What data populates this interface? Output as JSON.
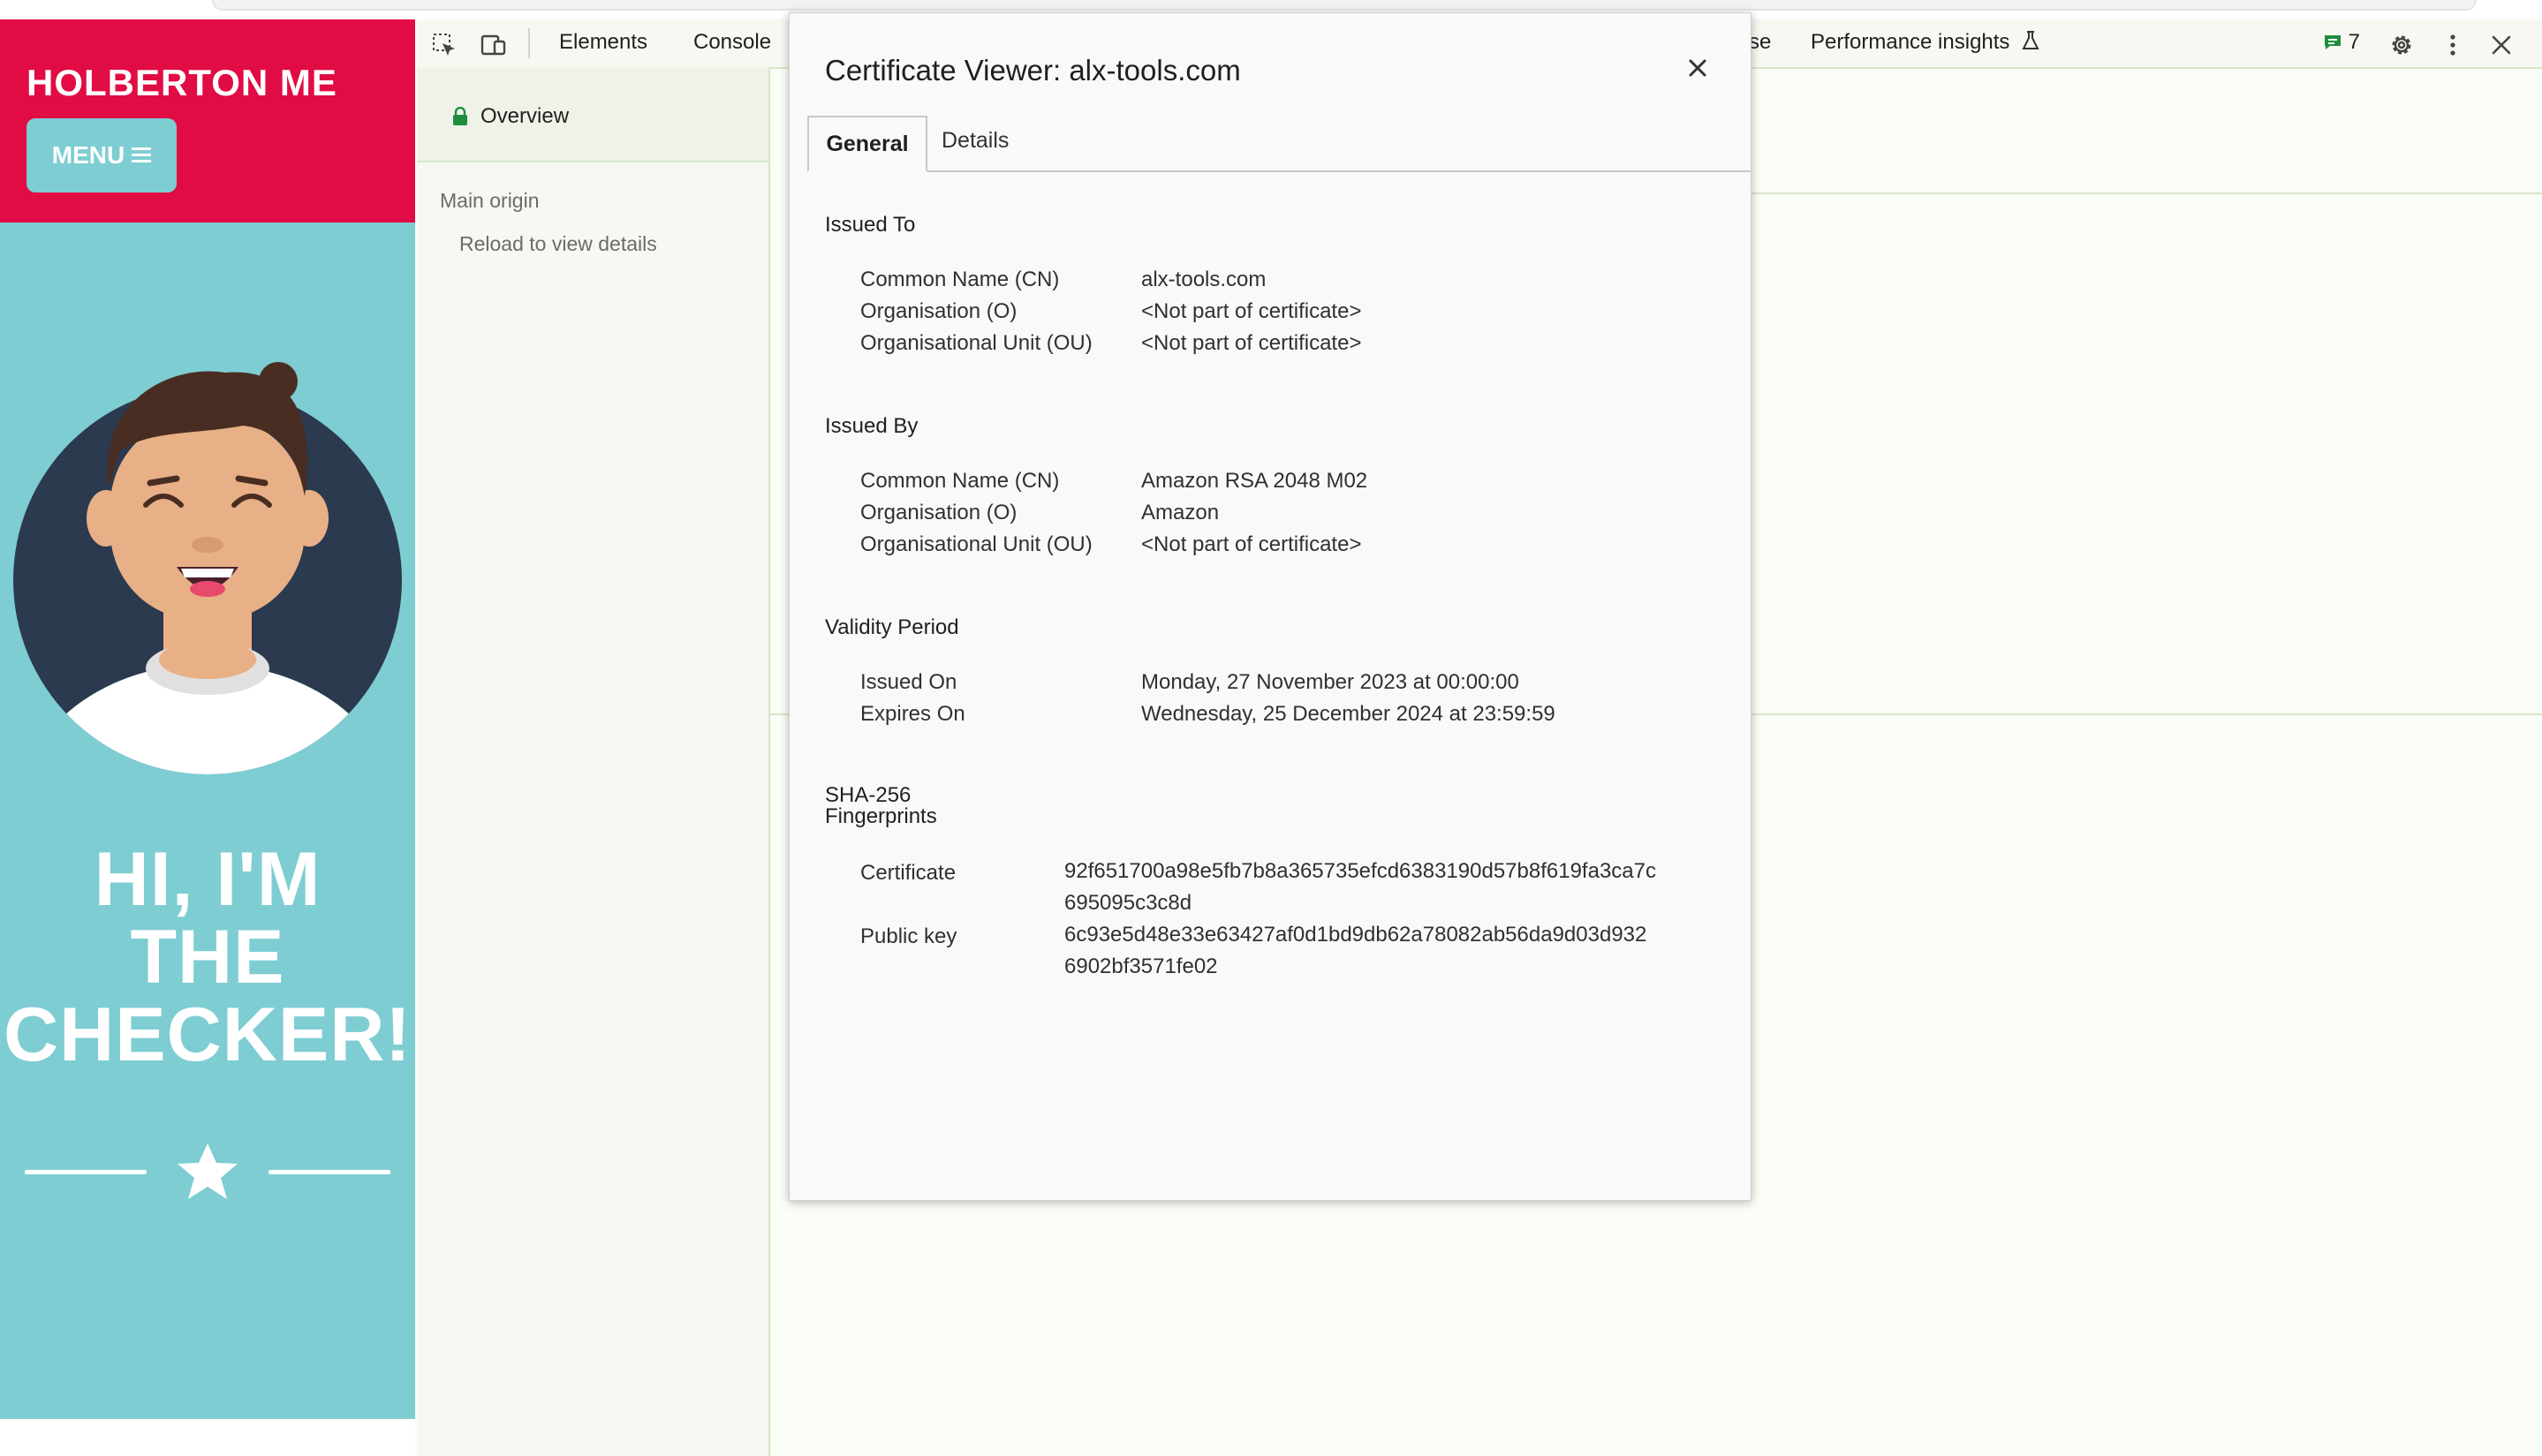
{
  "site": {
    "title": "HOLBERTON ME",
    "menu_label": "MENU",
    "hero_lines": [
      "HI, I'M",
      "THE",
      "CHECKER!"
    ]
  },
  "devtools": {
    "tabs": [
      "Elements",
      "Console"
    ],
    "partial_tab": "se",
    "perf_insights": "Performance insights",
    "issues_count": "7"
  },
  "security": {
    "overview_label": "Overview",
    "main_origin": "Main origin",
    "reload_hint": "Reload to view details"
  },
  "certificate": {
    "title": "Certificate Viewer: alx-tools.com",
    "tabs": {
      "general": "General",
      "details": "Details"
    },
    "issued_to": {
      "heading": "Issued To",
      "rows": [
        {
          "label": "Common Name (CN)",
          "value": "alx-tools.com"
        },
        {
          "label": "Organisation (O)",
          "value": "<Not part of certificate>"
        },
        {
          "label": "Organisational Unit (OU)",
          "value": "<Not part of certificate>"
        }
      ]
    },
    "issued_by": {
      "heading": "Issued By",
      "rows": [
        {
          "label": "Common Name (CN)",
          "value": "Amazon RSA 2048 M02"
        },
        {
          "label": "Organisation (O)",
          "value": "Amazon"
        },
        {
          "label": "Organisational Unit (OU)",
          "value": "<Not part of certificate>"
        }
      ]
    },
    "validity": {
      "heading": "Validity Period",
      "rows": [
        {
          "label": "Issued On",
          "value": "Monday, 27 November 2023 at 00:00:00"
        },
        {
          "label": "Expires On",
          "value": "Wednesday, 25 December 2024 at 23:59:59"
        }
      ]
    },
    "fingerprints": {
      "heading_line1": "SHA-256",
      "heading_line2": "Fingerprints",
      "rows": [
        {
          "label": "Certificate",
          "line1": "92f651700a98e5fb7b8a365735efcd6383190d57b8f619fa3ca7c",
          "line2": "695095c3c8d"
        },
        {
          "label": "Public key",
          "line1": "6c93e5d48e33e63427af0d1bd9db62a78082ab56da9d03d932",
          "line2": "6902bf3571fe02"
        }
      ]
    }
  },
  "colors": {
    "brand_red": "#e10c44",
    "brand_teal": "#7ecdd2",
    "secure_green": "#1e8e3e"
  },
  "icons": [
    "select-element-icon",
    "device-toolbar-icon",
    "flask-icon",
    "issues-icon",
    "gear-icon",
    "more-vert-icon",
    "close-icon",
    "lock-icon",
    "star-icon",
    "menu-hamburger-icon"
  ]
}
